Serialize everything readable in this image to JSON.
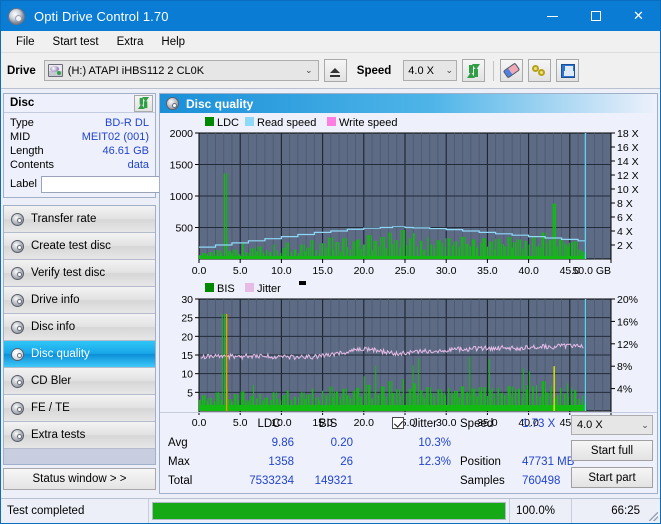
{
  "window": {
    "title": "Opti Drive Control 1.70",
    "icon": "disc-icon",
    "minimize": "–",
    "maximize": "□",
    "close": "✕"
  },
  "menu": {
    "items": [
      "File",
      "Start test",
      "Extra",
      "Help"
    ]
  },
  "toolbar": {
    "drive_label": "Drive",
    "drive_value": "(H:)   ATAPI iHBS112  2 CL0K",
    "eject_icon": "eject-icon",
    "speed_label": "Speed",
    "speed_value": "4.0 X",
    "refresh_icon": "refresh-icon",
    "eraser_icon": "eraser-icon",
    "keys_icon": "keys-icon",
    "save_icon": "floppy-save-icon"
  },
  "disc_panel": {
    "title": "Disc",
    "refresh_icon": "refresh-icon",
    "rows": [
      {
        "key": "Type",
        "value": "BD-R DL"
      },
      {
        "key": "MID",
        "value": "MEIT02 (001)"
      },
      {
        "key": "Length",
        "value": "46.61 GB"
      },
      {
        "key": "Contents",
        "value": "data"
      }
    ],
    "label_key": "Label",
    "label_value": "",
    "label_button_icon": "disc-label-icon"
  },
  "nav": {
    "items": [
      {
        "label": "Transfer rate",
        "icon": "disc-icon",
        "active": false
      },
      {
        "label": "Create test disc",
        "icon": "disc-icon",
        "active": false
      },
      {
        "label": "Verify test disc",
        "icon": "disc-icon",
        "active": false
      },
      {
        "label": "Drive info",
        "icon": "disc-icon",
        "active": false
      },
      {
        "label": "Disc info",
        "icon": "disc-icon",
        "active": false
      },
      {
        "label": "Disc quality",
        "icon": "disc-icon",
        "active": true
      },
      {
        "label": "CD Bler",
        "icon": "disc-icon",
        "active": false
      },
      {
        "label": "FE / TE",
        "icon": "disc-icon",
        "active": false
      },
      {
        "label": "Extra tests",
        "icon": "disc-icon",
        "active": false
      }
    ],
    "status_window": "Status window > >"
  },
  "panel": {
    "title": "Disc quality",
    "icon": "disc-icon"
  },
  "stats": {
    "col_ldc": "LDC",
    "col_bis": "BIS",
    "jitter_label": "Jitter",
    "jitter_checked": true,
    "row_avg": "Avg",
    "row_max": "Max",
    "row_total": "Total",
    "ldc_avg": "9.86",
    "ldc_max": "1358",
    "ldc_total": "7533234",
    "bis_avg": "0.20",
    "bis_max": "26",
    "bis_total": "149321",
    "jitter_avg": "10.3%",
    "jitter_max": "12.3%",
    "speed_label": "Speed",
    "speed_value": "1.73 X",
    "position_label": "Position",
    "position_value": "47731 MB",
    "samples_label": "Samples",
    "samples_value": "760498",
    "speed_select": "4.0 X",
    "start_full": "Start full",
    "start_part": "Start part"
  },
  "statusbar": {
    "message": "Test completed",
    "progress_percent": 100.0,
    "progress_text": "100.0%",
    "elapsed": "66:25"
  },
  "colors": {
    "accent": "#0a7cd4",
    "plot_bg": "#5d6b85",
    "ldc_green": "#11bb11",
    "read_speed": "#8ed8f8",
    "write_speed": "#ff7fe0",
    "jitter_pink": "#e6bce6",
    "value_blue": "#2244cc",
    "marker_yellow": "#e8e800",
    "end_marker": "#5ad2f5"
  },
  "chart_data": [
    {
      "type": "area",
      "id": "disc-quality-ldc",
      "title": "",
      "xlabel": "GB",
      "ylabel": "LDC",
      "legend": [
        {
          "name": "LDC",
          "color": "#008800"
        },
        {
          "name": "Read speed",
          "color": "#8ed8f8"
        },
        {
          "name": "Write speed",
          "color": "#ff7fe0"
        }
      ],
      "legend_position": "top-left",
      "grid": true,
      "xlim": [
        0,
        50
      ],
      "xticks": [
        0.0,
        5.0,
        10.0,
        15.0,
        20.0,
        25.0,
        30.0,
        35.0,
        40.0,
        45.0,
        50.0
      ],
      "xticklabels": [
        "0.0",
        "5.0",
        "10.0",
        "15.0",
        "20.0",
        "25.0",
        "30.0",
        "35.0",
        "40.0",
        "45.0",
        "50.0 GB"
      ],
      "ylim": [
        0,
        2000
      ],
      "yticks": [
        500,
        1000,
        1500,
        2000
      ],
      "yticklabels": [
        "500",
        "1000",
        "1500",
        "2000"
      ],
      "y2lim": [
        0,
        18
      ],
      "y2ticks": [
        2,
        4,
        6,
        8,
        10,
        12,
        14,
        16,
        18
      ],
      "y2ticklabels": [
        "2 X",
        "4 X",
        "6 X",
        "8 X",
        "10 X",
        "12 X",
        "14 X",
        "16 X",
        "18 X"
      ],
      "series": [
        {
          "name": "LDC",
          "color": "#11bb11",
          "axis": "left",
          "kind": "impulse",
          "x": [
            0.2,
            0.6,
            1.0,
            1.4,
            1.9,
            2.3,
            2.7,
            3.1,
            3.35,
            3.6,
            4.0,
            4.4,
            4.8,
            5.3,
            5.7,
            6.1,
            6.5,
            7.0,
            7.4,
            7.8,
            8.2,
            8.7,
            9.1,
            9.5,
            9.9,
            10.4,
            10.8,
            11.2,
            11.6,
            12.1,
            12.5,
            12.9,
            13.3,
            13.8,
            14.2,
            14.6,
            15.0,
            15.5,
            15.9,
            16.3,
            16.7,
            17.2,
            17.6,
            18.0,
            18.4,
            18.9,
            19.3,
            19.7,
            20.1,
            20.6,
            21.0,
            21.4,
            21.8,
            22.3,
            22.7,
            23.1,
            23.5,
            24.0,
            24.4,
            24.8,
            25.2,
            25.7,
            26.1,
            26.5,
            26.9,
            27.4,
            27.8,
            28.2,
            28.6,
            29.1,
            29.5,
            29.9,
            30.3,
            30.8,
            31.2,
            31.6,
            32.0,
            32.5,
            32.9,
            33.3,
            33.7,
            34.2,
            34.6,
            35.0,
            35.4,
            35.9,
            36.3,
            36.7,
            37.1,
            37.6,
            38.0,
            38.4,
            38.8,
            39.3,
            39.7,
            40.1,
            40.5,
            41.0,
            41.4,
            41.8,
            42.2,
            42.7,
            43.1,
            43.3,
            43.5,
            43.9,
            44.4,
            44.8,
            45.2,
            45.6,
            46.1,
            46.5,
            46.8
          ],
          "y": [
            60,
            95,
            70,
            110,
            80,
            140,
            95,
            1358,
            320,
            130,
            90,
            150,
            75,
            260,
            110,
            95,
            170,
            120,
            200,
            95,
            145,
            110,
            230,
            130,
            95,
            175,
            260,
            110,
            150,
            95,
            230,
            120,
            180,
            300,
            140,
            95,
            250,
            180,
            340,
            150,
            270,
            120,
            330,
            190,
            150,
            280,
            310,
            160,
            230,
            380,
            140,
            290,
            200,
            350,
            170,
            420,
            240,
            300,
            180,
            460,
            220,
            330,
            410,
            200,
            290,
            150,
            350,
            230,
            170,
            300,
            250,
            190,
            330,
            210,
            280,
            160,
            350,
            240,
            200,
            310,
            175,
            260,
            330,
            195,
            280,
            150,
            320,
            240,
            200,
            350,
            180,
            270,
            310,
            165,
            290,
            230,
            350,
            200,
            180,
            420,
            250,
            300,
            880,
            160,
            200,
            310,
            230,
            190,
            260,
            280,
            150,
            120,
            90
          ]
        },
        {
          "name": "Read speed",
          "color": "#8ed8f8",
          "axis": "right",
          "kind": "line",
          "x": [
            0.0,
            2.0,
            4.0,
            6.0,
            8.0,
            10.0,
            12.0,
            14.0,
            16.0,
            18.0,
            20.0,
            22.0,
            23.5,
            25.0,
            26.0,
            28.0,
            30.0,
            32.0,
            34.0,
            36.0,
            38.0,
            40.0,
            42.0,
            44.0,
            46.0,
            46.9,
            46.9
          ],
          "y": [
            1.7,
            2.0,
            2.3,
            2.6,
            2.9,
            3.2,
            3.5,
            3.8,
            4.0,
            4.25,
            4.4,
            4.5,
            4.6,
            4.5,
            4.45,
            4.35,
            4.2,
            4.0,
            3.8,
            3.6,
            3.4,
            3.2,
            3.0,
            2.8,
            2.6,
            2.4,
            18.0
          ]
        }
      ],
      "markers": [
        {
          "name": "scan-end",
          "x": 46.9,
          "color": "#5ad2f5",
          "kind": "vline"
        }
      ]
    },
    {
      "type": "area",
      "id": "disc-quality-bis",
      "title": "",
      "xlabel": "GB",
      "ylabel": "BIS",
      "legend": [
        {
          "name": "BIS",
          "color": "#008800"
        },
        {
          "name": "Jitter",
          "color": "#e6bce6"
        }
      ],
      "legend_position": "top-left",
      "grid": true,
      "xlim": [
        0,
        50
      ],
      "xticks": [
        0.0,
        5.0,
        10.0,
        15.0,
        20.0,
        25.0,
        30.0,
        35.0,
        40.0,
        45.0,
        50.0
      ],
      "xticklabels": [
        "0.0",
        "5.0",
        "10.0",
        "15.0",
        "20.0",
        "25.0",
        "30.0",
        "35.0",
        "40.0",
        "45.0",
        "50.0 GB"
      ],
      "ylim": [
        0,
        30
      ],
      "yticks": [
        5,
        10,
        15,
        20,
        25,
        30
      ],
      "yticklabels": [
        "5",
        "10",
        "15",
        "20",
        "25",
        "30"
      ],
      "y2lim": [
        0,
        20
      ],
      "y2ticks": [
        4,
        8,
        12,
        16,
        20
      ],
      "y2ticklabels": [
        "4%",
        "8%",
        "12%",
        "16%",
        "20%"
      ],
      "series": [
        {
          "name": "BIS",
          "color": "#11bb11",
          "axis": "left",
          "kind": "impulse",
          "x": [
            0.2,
            0.6,
            1.0,
            1.4,
            1.9,
            2.3,
            2.7,
            3.1,
            3.35,
            3.6,
            4.0,
            4.4,
            4.8,
            5.3,
            5.7,
            6.1,
            6.5,
            7.0,
            7.4,
            7.8,
            8.2,
            8.7,
            9.1,
            9.5,
            9.9,
            10.4,
            10.8,
            11.2,
            11.6,
            12.1,
            12.5,
            12.9,
            13.3,
            13.8,
            14.2,
            14.6,
            15.0,
            15.5,
            15.9,
            16.3,
            16.7,
            17.2,
            17.6,
            18.0,
            18.4,
            18.9,
            19.3,
            19.7,
            20.1,
            20.6,
            21.0,
            21.4,
            21.8,
            22.3,
            22.7,
            23.1,
            23.5,
            24.0,
            24.4,
            24.8,
            25.2,
            25.7,
            26.1,
            26.5,
            26.9,
            27.4,
            27.8,
            28.2,
            28.6,
            29.1,
            29.5,
            29.9,
            30.3,
            30.8,
            31.2,
            31.6,
            32.0,
            32.5,
            32.9,
            33.3,
            33.7,
            34.2,
            34.6,
            35.0,
            35.4,
            35.9,
            36.3,
            36.7,
            37.1,
            37.6,
            38.0,
            38.4,
            38.8,
            39.3,
            39.7,
            40.1,
            40.5,
            41.0,
            41.4,
            41.8,
            42.2,
            42.7,
            43.1,
            43.3,
            43.5,
            43.9,
            44.4,
            44.8,
            45.2,
            45.6,
            46.1,
            46.5,
            46.8
          ],
          "y": [
            3.0,
            4.2,
            2.8,
            3.5,
            2.6,
            5.0,
            3.0,
            26.0,
            6.0,
            3.2,
            2.5,
            4.5,
            2.8,
            5.2,
            3.0,
            2.6,
            4.0,
            3.4,
            4.6,
            2.8,
            3.6,
            3.0,
            5.0,
            3.2,
            2.8,
            4.2,
            5.5,
            3.0,
            3.8,
            2.6,
            5.0,
            3.2,
            4.4,
            6.0,
            3.6,
            2.8,
            5.4,
            4.2,
            6.5,
            3.6,
            5.2,
            3.0,
            6.0,
            4.2,
            3.4,
            5.4,
            6.2,
            3.8,
            4.6,
            7.0,
            3.4,
            5.6,
            4.4,
            6.6,
            3.8,
            8.0,
            4.8,
            5.8,
            4.0,
            8.6,
            4.6,
            6.0,
            7.4,
            4.2,
            5.6,
            3.4,
            6.4,
            4.8,
            3.8,
            5.8,
            5.0,
            4.2,
            6.2,
            4.4,
            5.4,
            3.6,
            6.6,
            5.0,
            4.2,
            6.0,
            3.8,
            5.2,
            6.4,
            4.0,
            5.6,
            3.4,
            6.2,
            4.8,
            4.2,
            6.6,
            3.8,
            5.4,
            6.0,
            3.6,
            5.8,
            4.6,
            6.6,
            4.2,
            3.8,
            8.0,
            5.0,
            6.0,
            12.0,
            3.4,
            4.2,
            6.2,
            4.6,
            3.8,
            5.2,
            5.6,
            3.2,
            2.6,
            2.0
          ]
        },
        {
          "name": "Jitter",
          "color": "#e6bce6",
          "axis": "right",
          "kind": "line",
          "x": [
            0.2,
            1.0,
            2.0,
            3.0,
            4.0,
            5.0,
            6.0,
            7.0,
            8.0,
            9.0,
            10.0,
            11.0,
            12.0,
            13.0,
            14.0,
            15.0,
            16.0,
            17.0,
            18.0,
            19.0,
            20.0,
            21.0,
            22.0,
            23.0,
            24.0,
            25.0,
            26.0,
            27.0,
            28.0,
            29.0,
            30.0,
            31.0,
            32.0,
            33.0,
            34.0,
            35.0,
            36.0,
            37.0,
            38.0,
            39.0,
            40.0,
            41.0,
            42.0,
            43.0,
            44.0,
            45.0,
            46.0,
            46.7
          ],
          "y": [
            9.5,
            9.7,
            9.8,
            9.7,
            9.8,
            9.7,
            9.8,
            9.7,
            9.8,
            9.7,
            9.8,
            9.7,
            9.6,
            9.7,
            9.7,
            9.8,
            10.0,
            10.3,
            10.6,
            10.8,
            11.0,
            10.9,
            10.7,
            10.4,
            10.2,
            10.3,
            10.5,
            10.6,
            10.7,
            10.8,
            10.9,
            11.0,
            11.0,
            11.1,
            11.2,
            11.2,
            11.2,
            11.3,
            11.3,
            11.2,
            11.3,
            11.4,
            11.5,
            11.4,
            11.6,
            11.7,
            11.8,
            11.5
          ]
        }
      ],
      "markers": [
        {
          "name": "spike-early",
          "x": 3.35,
          "color": "#e8a000",
          "kind": "vline-partial",
          "value": 26
        },
        {
          "name": "spike-late",
          "x": 43.1,
          "color": "#e8e800",
          "kind": "vline-partial",
          "value": 12
        },
        {
          "name": "scan-end",
          "x": 46.9,
          "color": "#5ad2f5",
          "kind": "vline"
        }
      ]
    }
  ]
}
